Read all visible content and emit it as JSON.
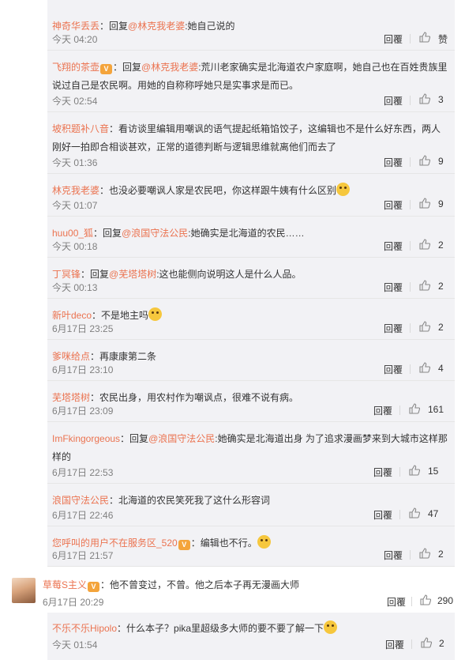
{
  "replies": [
    {
      "name": "神奇华丢丢",
      "vip": false,
      "prefix": "：回复",
      "mention": "@林克我老婆",
      "body": ":她自己说的",
      "emoji": false,
      "time": "今天 04:20",
      "reply_label": "回覆",
      "likes": "赞"
    },
    {
      "name": "飞翔的茶壶",
      "vip": true,
      "prefix": "：回复",
      "mention": "@林克我老婆",
      "body": ":荒川老家确实是北海道农户家庭啊，她自己也在百姓贵族里说过自己是农民啊。用她的自称称呼她只是实事求是而已。",
      "emoji": false,
      "time": "今天 02:54",
      "reply_label": "回覆",
      "likes": "3"
    },
    {
      "name": "坡积题补八音",
      "vip": false,
      "prefix": "：看访谈里编辑用嘲讽的语气提起纸箱馅饺子，这编辑也不是什么好东西，两人刚好一拍即合相谈甚欢，正常的道德判断与逻辑思维就离他们而去了",
      "mention": "",
      "body": "",
      "emoji": false,
      "time": "今天 01:36",
      "reply_label": "回覆",
      "likes": "9"
    },
    {
      "name": "林克我老婆",
      "vip": false,
      "prefix": "：也没必要嘲讽人家是农民吧，你这样跟牛姨有什么区别",
      "mention": "",
      "body": "",
      "emoji": true,
      "time": "今天 01:07",
      "reply_label": "回覆",
      "likes": "9"
    },
    {
      "name": "huu00_狐",
      "vip": false,
      "prefix": "：回复",
      "mention": "@浪国守法公民",
      "body": ":她确实是北海道的农民……",
      "emoji": false,
      "time": "今天 00:18",
      "reply_label": "回覆",
      "likes": "2"
    },
    {
      "name": "丁冥锋",
      "vip": false,
      "prefix": "：回复",
      "mention": "@芜塔塔树",
      "body": ":这也能侧向说明这人是什么人品。",
      "emoji": false,
      "time": "今天 00:13",
      "reply_label": "回覆",
      "likes": "2"
    },
    {
      "name": "新叶deco",
      "vip": false,
      "prefix": "：不是地主吗",
      "mention": "",
      "body": "",
      "emoji": true,
      "time": "6月17日 23:25",
      "reply_label": "回覆",
      "likes": "2"
    },
    {
      "name": "爹咪给点",
      "vip": false,
      "prefix": "：再康康第二条",
      "mention": "",
      "body": "",
      "emoji": false,
      "time": "6月17日 23:10",
      "reply_label": "回覆",
      "likes": "4"
    },
    {
      "name": "芜塔塔树",
      "vip": false,
      "prefix": "：农民出身，用农村作为嘲讽点，很难不说有病。",
      "mention": "",
      "body": "",
      "emoji": false,
      "time": "6月17日 23:09",
      "reply_label": "回覆",
      "likes": "161"
    },
    {
      "name": "ImFkingorgeous",
      "vip": false,
      "prefix": "：回复",
      "mention": "@浪国守法公民",
      "body": ":她确实是北海道出身 为了追求漫画梦来到大城市这样那样的",
      "emoji": false,
      "time": "6月17日 22:53",
      "reply_label": "回覆",
      "likes": "15"
    },
    {
      "name": "浪国守法公民",
      "vip": false,
      "prefix": "：北海道的农民笑死我了这什么形容词",
      "mention": "",
      "body": "",
      "emoji": false,
      "time": "6月17日 22:46",
      "reply_label": "回覆",
      "likes": "47"
    },
    {
      "name": "您呼叫的用户不在服务区_520",
      "vip": true,
      "prefix": "：编辑也不行。",
      "mention": "",
      "body": "",
      "emoji": true,
      "time": "6月17日 21:57",
      "reply_label": "回覆",
      "likes": "2"
    }
  ],
  "main_comment": {
    "name": "草莓S主义",
    "vip": true,
    "text": "：他不曾变过，不曾。他之后本子再无漫画大师",
    "time": "6月17日 20:29",
    "reply_label": "回覆",
    "likes": "290"
  },
  "sub_reply": {
    "name": "不乐不乐Hipolo",
    "prefix": "：什么本子？pika里超级多大师的要不要了解一下",
    "time": "今天 01:54",
    "reply_label": "回覆",
    "likes": "2"
  }
}
